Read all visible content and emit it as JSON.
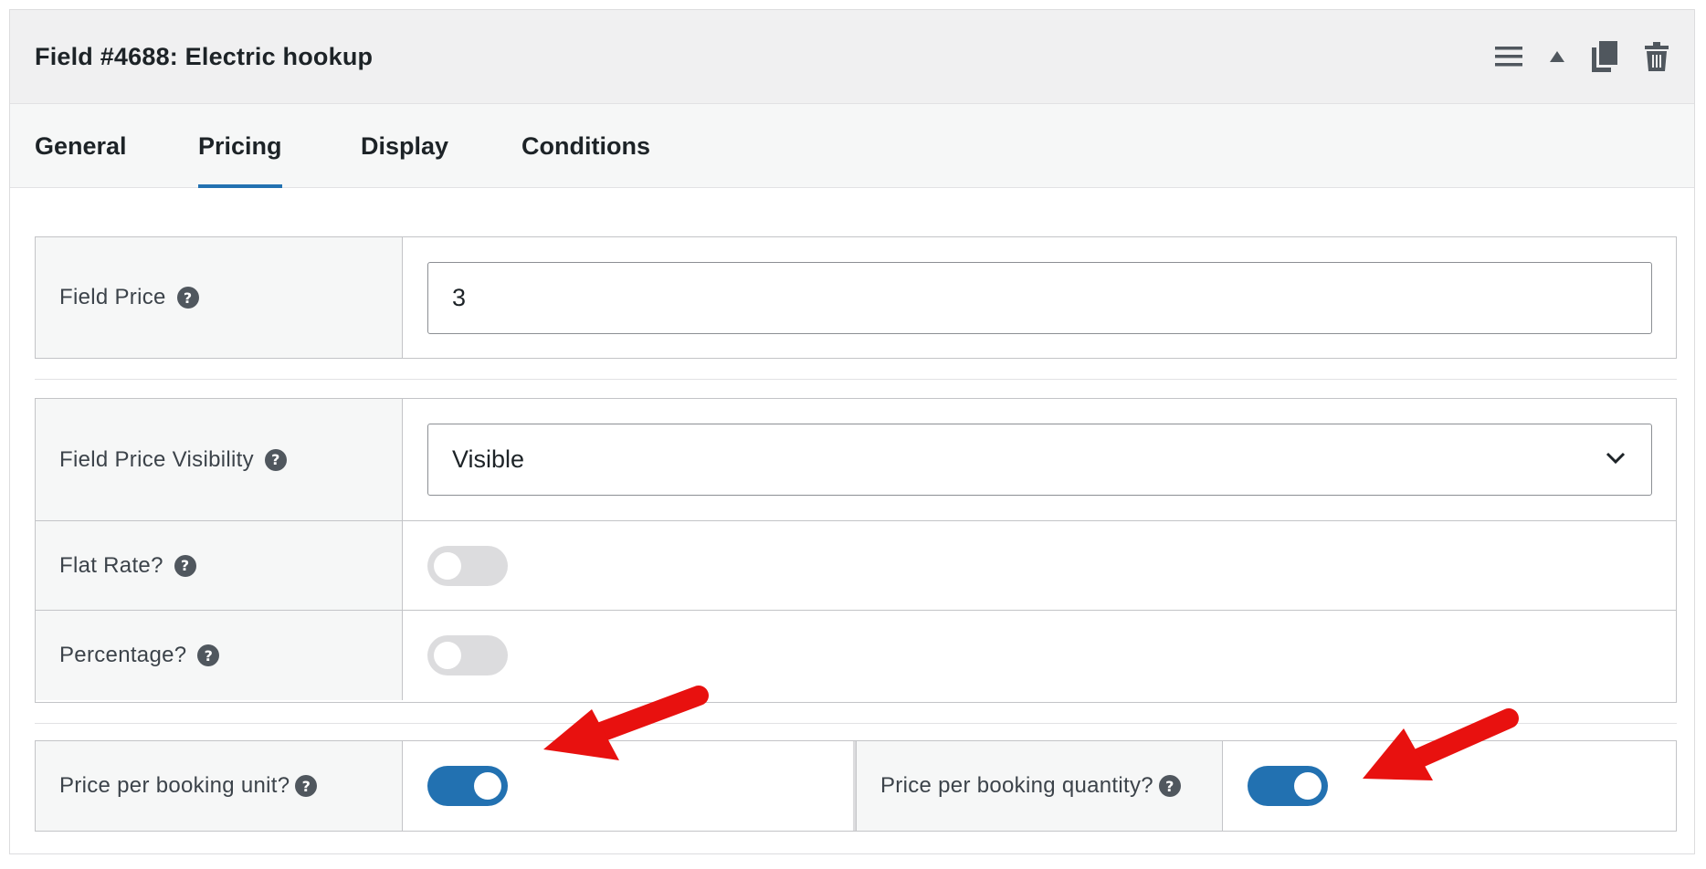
{
  "header": {
    "title": "Field #4688: Electric hookup",
    "icons": [
      "menu-icon",
      "collapse-up-icon",
      "duplicate-icon",
      "trash-icon"
    ]
  },
  "tabs": [
    {
      "label": "General",
      "active": false
    },
    {
      "label": "Pricing",
      "active": true
    },
    {
      "label": "Display",
      "active": false
    },
    {
      "label": "Conditions",
      "active": false
    }
  ],
  "fields": {
    "field_price": {
      "label": "Field Price",
      "value": "3",
      "help": "?"
    },
    "field_price_visibility": {
      "label": "Field Price Visibility",
      "selected": "Visible",
      "help": "?"
    },
    "flat_rate": {
      "label": "Flat Rate?",
      "checked": false,
      "help": "?"
    },
    "percentage": {
      "label": "Percentage?",
      "checked": false,
      "help": "?"
    },
    "price_per_booking_unit": {
      "label": "Price per booking unit?",
      "checked": true,
      "help": "?"
    },
    "price_per_booking_quantity": {
      "label": "Price per booking quantity?",
      "checked": true,
      "help": "?"
    }
  },
  "colors": {
    "accent": "#2271b1",
    "toggle_off": "#dcdcde",
    "annotation_arrow": "#e8110f"
  }
}
